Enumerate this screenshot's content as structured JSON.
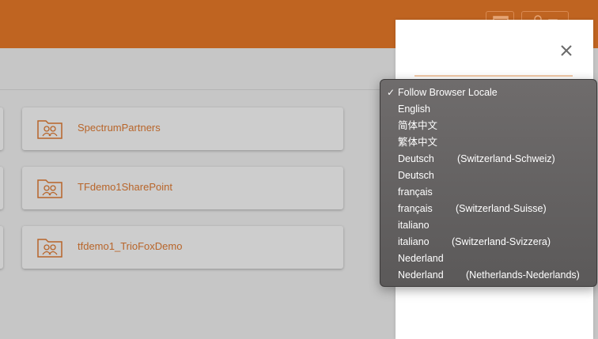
{
  "colors": {
    "topbar": "#bf6421",
    "accent_text": "#b8652a",
    "overlay_bg": "#c6c6c6",
    "menu_bg": "#656262"
  },
  "topbar": {
    "icons": [
      "window-icon",
      "user-icon"
    ]
  },
  "folders": [
    {
      "name": "SpectrumPartners",
      "icon": "shared-folder-icon"
    },
    {
      "name": "TFdemo1SharePoint",
      "icon": "shared-folder-icon"
    },
    {
      "name": "tfdemo1_TrioFoxDemo",
      "icon": "shared-folder-icon"
    }
  ],
  "dialog": {
    "close_icon": "close-icon"
  },
  "language_menu": {
    "selected_index": 0,
    "check_mark": "✓",
    "options": [
      {
        "label": "Follow Browser Locale",
        "region": ""
      },
      {
        "label": "English",
        "region": ""
      },
      {
        "label": "简体中文",
        "region": ""
      },
      {
        "label": "繁体中文",
        "region": ""
      },
      {
        "label": "Deutsch",
        "region": "(Switzerland-Schweiz)"
      },
      {
        "label": "Deutsch",
        "region": ""
      },
      {
        "label": "français",
        "region": ""
      },
      {
        "label": "français",
        "region": "(Switzerland-Suisse)"
      },
      {
        "label": "italiano",
        "region": ""
      },
      {
        "label": "italiano",
        "region": "(Switzerland-Svizzera)"
      },
      {
        "label": "Nederland",
        "region": ""
      },
      {
        "label": "Nederland",
        "region": "(Netherlands-Nederlands)"
      }
    ]
  }
}
